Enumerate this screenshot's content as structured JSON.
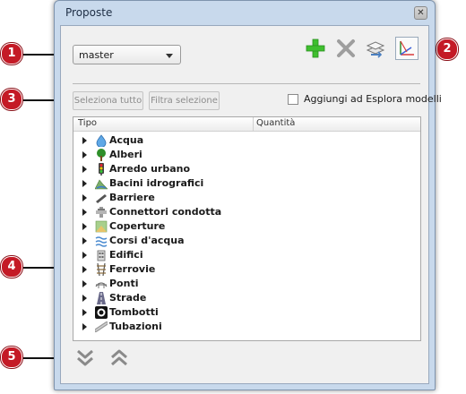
{
  "window": {
    "title": "Proposte",
    "close_glyph": "✕"
  },
  "branch": {
    "value": "master"
  },
  "toolbar": {
    "add_icon": "plus-icon",
    "remove_icon": "delete-icon",
    "merge_icon": "layers-icon",
    "axes_icon": "axes-icon",
    "colors": {
      "add": "#3fbf2f",
      "remove": "#9e9e9e",
      "axes": "#d93a3a"
    }
  },
  "actions": {
    "select_all": "Seleziona tutto",
    "filter_selection": "Filtra selezione",
    "add_to_explorer": "Aggiungi ad Esplora modelli"
  },
  "tree": {
    "columns": [
      "Tipo",
      "Quantità"
    ],
    "items": [
      {
        "label": "Acqua",
        "icon": "water-drop-icon"
      },
      {
        "label": "Alberi",
        "icon": "tree-icon"
      },
      {
        "label": "Arredo urbano",
        "icon": "traffic-light-icon"
      },
      {
        "label": "Bacini idrografici",
        "icon": "basin-icon"
      },
      {
        "label": "Barriere",
        "icon": "barrier-icon"
      },
      {
        "label": "Connettori condotta",
        "icon": "pipe-connector-icon"
      },
      {
        "label": "Coperture",
        "icon": "coverage-icon"
      },
      {
        "label": "Corsi d'acqua",
        "icon": "waves-icon"
      },
      {
        "label": "Edifici",
        "icon": "building-icon"
      },
      {
        "label": "Ferrovie",
        "icon": "railway-icon"
      },
      {
        "label": "Ponti",
        "icon": "bridge-icon"
      },
      {
        "label": "Strade",
        "icon": "road-icon"
      },
      {
        "label": "Tombotti",
        "icon": "culvert-icon"
      },
      {
        "label": "Tubazioni",
        "icon": "pipe-icon"
      }
    ]
  },
  "bottom": {
    "expand_icon": "double-chevron-down-icon",
    "collapse_icon": "double-chevron-up-icon"
  },
  "callouts": [
    "1",
    "2",
    "3",
    "4",
    "5"
  ]
}
